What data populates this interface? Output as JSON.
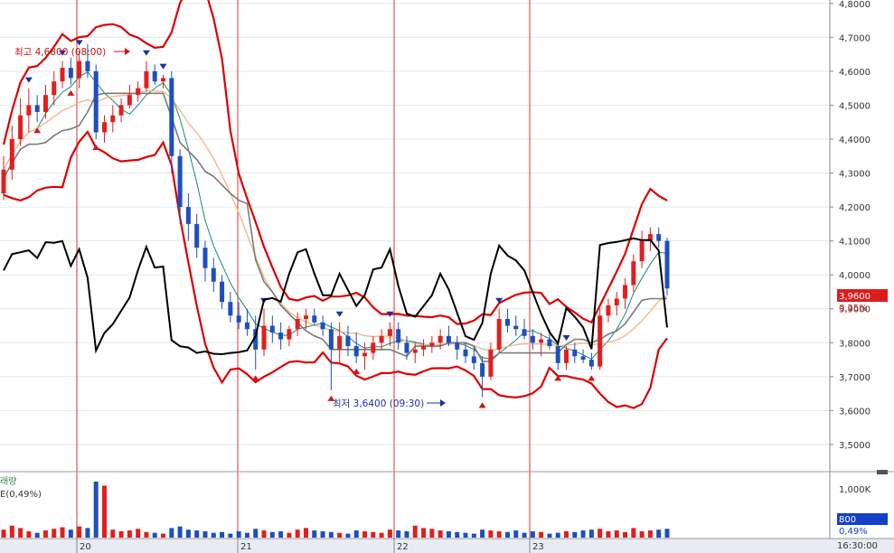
{
  "chart_data": {
    "type": "candlestick",
    "y_ticks": [
      "4,8000",
      "4,7000",
      "4,6000",
      "4,5000",
      "4,4000",
      "4,3000",
      "4,2000",
      "4,1000",
      "4,0000",
      "3,9000",
      "3,8000",
      "3,7000",
      "3,6000",
      "3,5000"
    ],
    "ylim": [
      3.42,
      4.81
    ],
    "x_day_labels": [
      "20",
      "21",
      "22",
      "23"
    ],
    "x_day_positions": [
      85,
      263,
      436,
      586
    ],
    "time_label": "16:30:00",
    "current_price": "3,9600",
    "current_change": "0,25%",
    "high_annotation": "최고 4,6800 (08:00)",
    "low_annotation": "최저 3,6400 (09:30)",
    "volume_title": "래량",
    "volume_sub": "E(0,49%)",
    "volume_tick": "1,000K",
    "volume_current": "800",
    "volume_change": "0,49%",
    "colors": {
      "up": "#e21e1e",
      "down": "#1e4fbf",
      "band": "#dd0000",
      "fast_ma": "#14897a",
      "slow_ma": "#f3b88a",
      "channel": "#7b7b7b",
      "oscillator": "#000000"
    },
    "candles": [
      [
        4.24,
        4.35,
        4.22,
        4.31
      ],
      [
        4.31,
        4.44,
        4.28,
        4.4
      ],
      [
        4.4,
        4.52,
        4.38,
        4.47
      ],
      [
        4.47,
        4.55,
        4.42,
        4.5
      ],
      [
        4.5,
        4.53,
        4.45,
        4.48
      ],
      [
        4.48,
        4.56,
        4.46,
        4.53
      ],
      [
        4.53,
        4.6,
        4.5,
        4.57
      ],
      [
        4.57,
        4.63,
        4.55,
        4.61
      ],
      [
        4.61,
        4.64,
        4.56,
        4.58
      ],
      [
        4.58,
        4.66,
        4.55,
        4.63
      ],
      [
        4.63,
        4.68,
        4.58,
        4.6
      ],
      [
        4.6,
        4.62,
        4.4,
        4.42
      ],
      [
        4.42,
        4.47,
        4.39,
        4.45
      ],
      [
        4.45,
        4.5,
        4.42,
        4.47
      ],
      [
        4.47,
        4.52,
        4.45,
        4.5
      ],
      [
        4.5,
        4.56,
        4.49,
        4.53
      ],
      [
        4.53,
        4.57,
        4.51,
        4.55
      ],
      [
        4.55,
        4.63,
        4.54,
        4.6
      ],
      [
        4.6,
        4.62,
        4.56,
        4.57
      ],
      [
        4.57,
        4.59,
        4.55,
        4.58
      ],
      [
        4.58,
        4.6,
        4.3,
        4.35
      ],
      [
        4.35,
        4.37,
        4.15,
        4.2
      ],
      [
        4.2,
        4.24,
        4.1,
        4.15
      ],
      [
        4.15,
        4.18,
        4.05,
        4.08
      ],
      [
        4.08,
        4.1,
        3.98,
        4.02
      ],
      [
        4.02,
        4.05,
        3.95,
        3.98
      ],
      [
        3.98,
        4.0,
        3.9,
        3.92
      ],
      [
        3.92,
        3.95,
        3.86,
        3.88
      ],
      [
        3.88,
        3.92,
        3.84,
        3.86
      ],
      [
        3.86,
        3.9,
        3.82,
        3.84
      ],
      [
        3.84,
        3.88,
        3.72,
        3.78
      ],
      [
        3.78,
        3.9,
        3.76,
        3.85
      ],
      [
        3.85,
        3.88,
        3.8,
        3.83
      ],
      [
        3.83,
        3.86,
        3.78,
        3.81
      ],
      [
        3.81,
        3.85,
        3.79,
        3.84
      ],
      [
        3.84,
        3.89,
        3.82,
        3.87
      ],
      [
        3.87,
        3.9,
        3.84,
        3.88
      ],
      [
        3.88,
        3.9,
        3.85,
        3.86
      ],
      [
        3.86,
        3.88,
        3.82,
        3.84
      ],
      [
        3.84,
        3.86,
        3.66,
        3.78
      ],
      [
        3.78,
        3.86,
        3.74,
        3.82
      ],
      [
        3.82,
        3.85,
        3.76,
        3.79
      ],
      [
        3.79,
        3.83,
        3.74,
        3.76
      ],
      [
        3.76,
        3.8,
        3.72,
        3.77
      ],
      [
        3.77,
        3.82,
        3.75,
        3.8
      ],
      [
        3.8,
        3.84,
        3.78,
        3.82
      ],
      [
        3.82,
        3.86,
        3.79,
        3.84
      ],
      [
        3.84,
        3.86,
        3.78,
        3.8
      ],
      [
        3.8,
        3.82,
        3.75,
        3.77
      ],
      [
        3.77,
        3.8,
        3.74,
        3.78
      ],
      [
        3.78,
        3.81,
        3.76,
        3.79
      ],
      [
        3.79,
        3.82,
        3.77,
        3.8
      ],
      [
        3.8,
        3.84,
        3.78,
        3.82
      ],
      [
        3.82,
        3.85,
        3.79,
        3.8
      ],
      [
        3.8,
        3.82,
        3.75,
        3.78
      ],
      [
        3.78,
        3.8,
        3.74,
        3.76
      ],
      [
        3.76,
        3.79,
        3.72,
        3.74
      ],
      [
        3.74,
        3.76,
        3.64,
        3.7
      ],
      [
        3.7,
        3.8,
        3.69,
        3.78
      ],
      [
        3.78,
        3.9,
        3.77,
        3.87
      ],
      [
        3.87,
        3.9,
        3.83,
        3.85
      ],
      [
        3.85,
        3.88,
        3.82,
        3.84
      ],
      [
        3.84,
        3.87,
        3.81,
        3.82
      ],
      [
        3.82,
        3.84,
        3.78,
        3.8
      ],
      [
        3.8,
        3.83,
        3.76,
        3.81
      ],
      [
        3.81,
        3.84,
        3.78,
        3.79
      ],
      [
        3.79,
        3.81,
        3.72,
        3.74
      ],
      [
        3.74,
        3.79,
        3.72,
        3.78
      ],
      [
        3.78,
        3.8,
        3.74,
        3.76
      ],
      [
        3.76,
        3.78,
        3.74,
        3.75
      ],
      [
        3.75,
        3.77,
        3.72,
        3.73
      ],
      [
        3.73,
        3.9,
        3.72,
        3.88
      ],
      [
        3.88,
        3.93,
        3.86,
        3.91
      ],
      [
        3.91,
        3.95,
        3.88,
        3.93
      ],
      [
        3.93,
        3.99,
        3.9,
        3.97
      ],
      [
        3.97,
        4.06,
        3.95,
        4.04
      ],
      [
        4.04,
        4.13,
        4.02,
        4.1
      ],
      [
        4.1,
        4.14,
        4.07,
        4.12
      ],
      [
        4.12,
        4.14,
        4.08,
        4.1
      ],
      [
        4.1,
        4.11,
        3.94,
        3.96
      ]
    ],
    "volume_scale": 1000,
    "volume": [
      10,
      15,
      12,
      8,
      6,
      9,
      11,
      13,
      10,
      14,
      12,
      70,
      65,
      10,
      8,
      9,
      11,
      7,
      6,
      5,
      12,
      14,
      10,
      9,
      8,
      6,
      7,
      5,
      8,
      6,
      11,
      9,
      7,
      8,
      6,
      10,
      12,
      9,
      8,
      7,
      6,
      5,
      9,
      8,
      7,
      6,
      10,
      9,
      8,
      15,
      12,
      11,
      9,
      8,
      7,
      6,
      5,
      10,
      9,
      8,
      7,
      9,
      6,
      8,
      7,
      5,
      6,
      8,
      7,
      9,
      10,
      11,
      8,
      9,
      7,
      12,
      8,
      9,
      10,
      11
    ]
  }
}
